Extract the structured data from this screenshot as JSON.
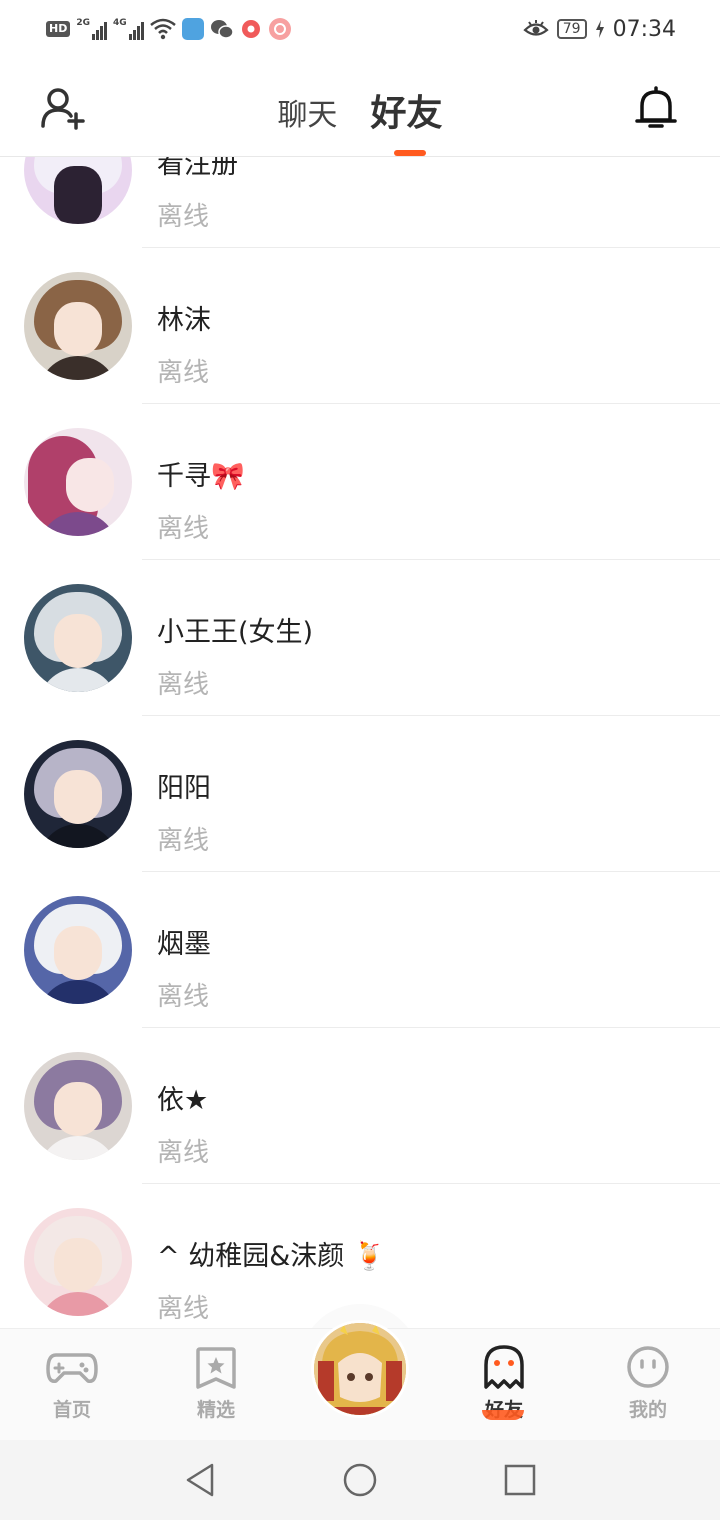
{
  "status_bar": {
    "hd": "HD",
    "net1": "2G",
    "net2": "4G",
    "battery": "79",
    "time": "07:34"
  },
  "header": {
    "tabs": [
      {
        "label": "聊天",
        "active": false
      },
      {
        "label": "好友",
        "active": true
      }
    ],
    "accent_color": "#ff5a1f"
  },
  "friends": [
    {
      "name": "看注册",
      "status": "离线"
    },
    {
      "name": "林沫",
      "status": "离线"
    },
    {
      "name": "千寻🎀",
      "status": "离线"
    },
    {
      "name": "小王王(女生)",
      "status": "离线"
    },
    {
      "name": "阳阳",
      "status": "离线"
    },
    {
      "name": "烟墨",
      "status": "离线"
    },
    {
      "name": "依★",
      "status": "离线"
    },
    {
      "name": "^ 幼稚园&沫颜 🍹",
      "status": "离线"
    }
  ],
  "bottom_nav": {
    "home": "首页",
    "featured": "精选",
    "friends": "好友",
    "me": "我的"
  }
}
